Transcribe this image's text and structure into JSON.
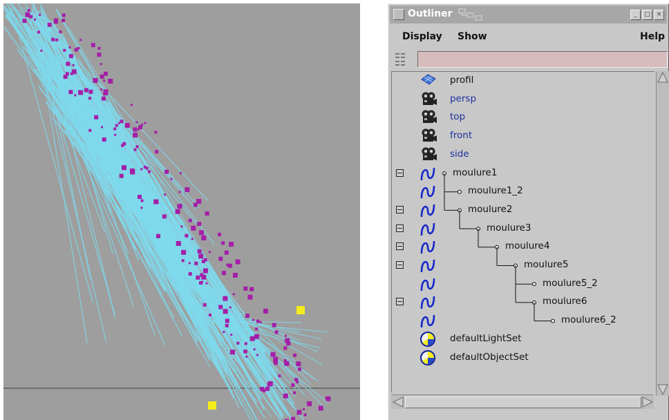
{
  "window": {
    "title": "Outliner",
    "buttons": {
      "minimize": "_",
      "maximize": "□",
      "close": "×"
    }
  },
  "menu": {
    "display": "Display",
    "show": "Show",
    "help": "Help"
  },
  "filter": {
    "value": ""
  },
  "tree": {
    "items": [
      {
        "label": "profil",
        "icon": "nurbs-surface-icon",
        "camera": false
      },
      {
        "label": "persp",
        "icon": "camera-icon",
        "camera": true
      },
      {
        "label": "top",
        "icon": "camera-icon",
        "camera": true
      },
      {
        "label": "front",
        "icon": "camera-icon",
        "camera": true
      },
      {
        "label": "side",
        "icon": "camera-icon",
        "camera": true
      },
      {
        "label": "moulure1",
        "icon": "curve-icon"
      },
      {
        "label": "moulure1_2",
        "icon": "curve-icon"
      },
      {
        "label": "moulure2",
        "icon": "curve-icon"
      },
      {
        "label": "moulure3",
        "icon": "curve-icon"
      },
      {
        "label": "moulure4",
        "icon": "curve-icon"
      },
      {
        "label": "moulure5",
        "icon": "curve-icon"
      },
      {
        "label": "moulure5_2",
        "icon": "curve-icon"
      },
      {
        "label": "moulure6",
        "icon": "curve-icon"
      },
      {
        "label": "moulure6_2",
        "icon": "curve-icon"
      },
      {
        "label": "defaultLightSet",
        "icon": "set-icon"
      },
      {
        "label": "defaultObjectSet",
        "icon": "set-icon"
      }
    ]
  },
  "colors": {
    "viewport_bg": "#9e9e9e",
    "wire": "#7fd9ec",
    "vertex": "#a41fa8",
    "selected_vertex": "#f4ec1c",
    "curve_icon": "#1628c8",
    "camera_label": "#1c2f9e"
  }
}
